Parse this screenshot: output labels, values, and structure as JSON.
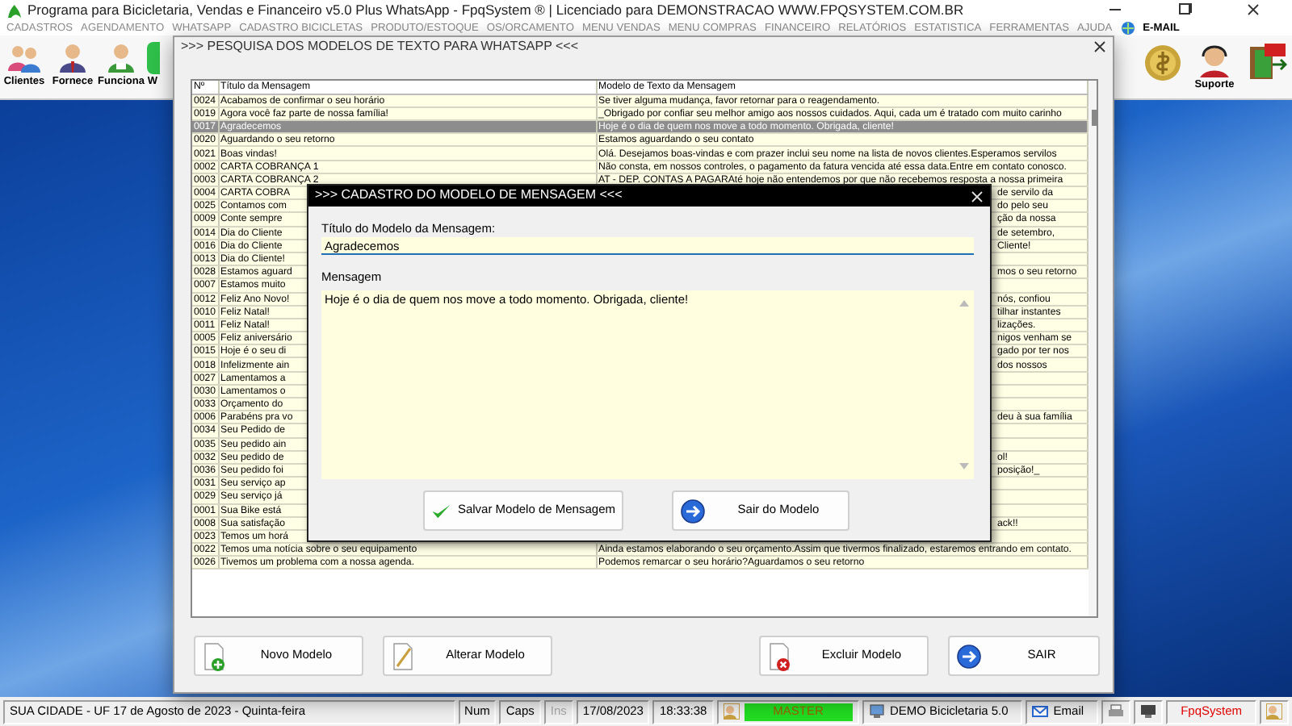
{
  "window": {
    "title": "Programa para Bicicletaria, Vendas e Financeiro v5.0 Plus WhatsApp - FpqSystem ® | Licenciado para  DEMONSTRACAO WWW.FPQSYSTEM.COM.BR"
  },
  "menu": [
    {
      "label": "CADASTROS",
      "disabled": true
    },
    {
      "label": "AGENDAMENTO",
      "disabled": true
    },
    {
      "label": "WHATSAPP",
      "disabled": true
    },
    {
      "label": "CADASTRO BICICLETAS",
      "disabled": true
    },
    {
      "label": "PRODUTO/ESTOQUE",
      "disabled": true
    },
    {
      "label": "OS/ORCAMENTO",
      "disabled": true
    },
    {
      "label": "MENU VENDAS",
      "disabled": true
    },
    {
      "label": "MENU COMPRAS",
      "disabled": true
    },
    {
      "label": "FINANCEIRO",
      "disabled": true
    },
    {
      "label": "RELATÓRIOS",
      "disabled": true
    },
    {
      "label": "ESTATISTICA",
      "disabled": true
    },
    {
      "label": "FERRAMENTAS",
      "disabled": true
    },
    {
      "label": "AJUDA",
      "disabled": true
    },
    {
      "label": "E-MAIL",
      "disabled": false
    }
  ],
  "toolbar_left": [
    {
      "kind": "clients",
      "label": "Clientes"
    },
    {
      "kind": "suppliers",
      "label": "Fornece"
    },
    {
      "kind": "staff",
      "label": "Funciona"
    },
    {
      "kind": "whatsapp",
      "label": "W"
    }
  ],
  "toolbar_right": [
    {
      "kind": "coin"
    },
    {
      "kind": "support",
      "label": "Suporte"
    },
    {
      "kind": "exit"
    }
  ],
  "search_dialog": {
    "title": ">>> PESQUISA DOS MODELOS DE TEXTO PARA WHATSAPP <<<",
    "columns": [
      "Nº",
      "Título da Mensagem",
      "Modelo de Texto da Mensagem"
    ],
    "rows": [
      {
        "number": "0024",
        "title": "Acabamos de confirmar o seu horário",
        "model": "Se tiver alguma mudança, favor retornar para o reagendamento.",
        "selected": false,
        "covered": false
      },
      {
        "number": "0019",
        "title": "Agora você faz parte de nossa família!",
        "model": "_Obrigado por confiar seu melhor amigo aos nossos cuidados. Aqui, cada um é tratado com muito carinho",
        "selected": false,
        "covered": false
      },
      {
        "number": "0017",
        "title": "Agradecemos",
        "model": "Hoje é o dia de quem nos move a todo momento. Obrigada, cliente!",
        "selected": true,
        "covered": false
      },
      {
        "number": "0020",
        "title": "Aguardando o seu retorno",
        "model": "Estamos aguardando o seu contato",
        "selected": false,
        "covered": false
      },
      {
        "number": "0021",
        "title": "Boas vindas!",
        "model": "Olá. Desejamos boas-vindas e com prazer inclui seu nome na lista de novos clientes.Esperamos servilos",
        "selected": false,
        "covered": false
      },
      {
        "number": "0002",
        "title": "CARTA COBRANÇA 1",
        "model": "Não consta, em nossos controles, o pagamento da fatura vencida até essa data.Entre em contato conosco.",
        "selected": false,
        "covered": false
      },
      {
        "number": "0003",
        "title": "CARTA COBRANÇA 2",
        "model": "AT - DEP. CONTAS A PAGARAté hoje não entendemos por que não recebemos resposta a nossa primeira",
        "selected": false,
        "covered": false
      },
      {
        "number": "0004",
        "title": "CARTA COBRA",
        "model": "de servilo da",
        "selected": false,
        "covered": true
      },
      {
        "number": "0025",
        "title": "Contamos com",
        "model": "do pelo seu",
        "selected": false,
        "covered": true
      },
      {
        "number": "0009",
        "title": "Conte sempre",
        "model": "ção da nossa",
        "selected": false,
        "covered": true
      },
      {
        "number": "0014",
        "title": "Dia do Cliente",
        "model": "de setembro,",
        "selected": false,
        "covered": true
      },
      {
        "number": "0016",
        "title": "Dia do Cliente",
        "model": "Cliente!",
        "selected": false,
        "covered": true
      },
      {
        "number": "0013",
        "title": "Dia do Cliente!",
        "selected": false
      },
      {
        "number": "0028",
        "title": "Estamos aguard",
        "model": "mos o seu retorno",
        "selected": false,
        "covered": true
      },
      {
        "number": "0007",
        "title": "Estamos muito",
        "selected": false
      },
      {
        "number": "0012",
        "title": "Feliz Ano Novo!",
        "model": "nós, confiou",
        "selected": false,
        "covered": true
      },
      {
        "number": "0010",
        "title": "Feliz Natal!",
        "model": "tilhar instantes",
        "selected": false,
        "covered": true
      },
      {
        "number": "0011",
        "title": "Feliz Natal!",
        "model": "lizações.",
        "selected": false,
        "covered": true
      },
      {
        "number": "0005",
        "title": "Feliz aniversário",
        "model": "nigos venham se",
        "selected": false,
        "covered": true
      },
      {
        "number": "0015",
        "title": "Hoje é o seu di",
        "model": "gado por ter nos",
        "selected": false,
        "covered": true
      },
      {
        "number": "0018",
        "title": "Infelizmente ain",
        "model": "dos nossos",
        "selected": false,
        "covered": true
      },
      {
        "number": "0027",
        "title": "Lamentamos a",
        "selected": false
      },
      {
        "number": "0030",
        "title": "Lamentamos o",
        "selected": false
      },
      {
        "number": "0033",
        "title": "Orçamento do",
        "selected": false
      },
      {
        "number": "0006",
        "title": "Parabéns pra vo",
        "model": "deu à sua família",
        "selected": false,
        "covered": true
      },
      {
        "number": "0034",
        "title": "Seu Pedido de",
        "selected": false
      },
      {
        "number": "0035",
        "title": "Seu pedido ain",
        "selected": false
      },
      {
        "number": "0032",
        "title": "Seu pedido de",
        "model": "ol!",
        "selected": false,
        "covered": true
      },
      {
        "number": "0036",
        "title": "Seu pedido foi",
        "model": "posição!_",
        "selected": false,
        "covered": true
      },
      {
        "number": "0031",
        "title": "Seu serviço ap",
        "selected": false
      },
      {
        "number": "0029",
        "title": "Seu serviço já",
        "selected": false
      },
      {
        "number": "0001",
        "title": "Sua Bike está",
        "selected": false
      },
      {
        "number": "0008",
        "title": "Sua satisfação",
        "model": "ack!!",
        "selected": false,
        "covered": true
      },
      {
        "number": "0023",
        "title": "Temos um horá",
        "selected": false
      },
      {
        "number": "0022",
        "title": "Temos uma notícia sobre o seu equipamento",
        "model": "Ainda estamos elaborando o seu orçamento.Assim que tivermos finalizado, estaremos entrando em contato.",
        "selected": false,
        "covered": false
      },
      {
        "number": "0026",
        "title": "Tivemos um problema com a nossa agenda.",
        "model": "Podemos remarcar o seu horário?Aguardamos o seu retorno",
        "selected": false,
        "covered": false
      }
    ],
    "buttons": [
      {
        "kind": "new",
        "label": "Novo Modelo"
      },
      {
        "kind": "edit",
        "label": "Alterar Modelo"
      },
      {
        "kind": "delete",
        "label": "Excluir Modelo"
      },
      {
        "kind": "exit",
        "label": "SAIR"
      }
    ]
  },
  "edit_dialog": {
    "title": ">>> CADASTRO DO MODELO DE MENSAGEM <<<",
    "title_label": "Título do Modelo da Mensagem:",
    "title_value": "Agradecemos",
    "message_label": "Mensagem",
    "message_value": "Hoje é o dia de quem nos move a todo momento. Obrigada, cliente!",
    "buttons": [
      {
        "kind": "save",
        "label": "Salvar Modelo de Mensagem"
      },
      {
        "kind": "exit",
        "label": "Sair do Modelo"
      }
    ]
  },
  "status_bar": [
    {
      "kind": "text",
      "text": "SUA CIDADE - UF 17 de Agosto de 2023 - Quinta-feira"
    },
    {
      "kind": "key",
      "text": "Num",
      "disabled": false
    },
    {
      "kind": "key",
      "text": "Caps",
      "disabled": false
    },
    {
      "kind": "key",
      "text": "Ins",
      "disabled": true
    },
    {
      "kind": "text",
      "text": "17/08/2023"
    },
    {
      "kind": "text",
      "text": "18:33:38"
    },
    {
      "kind": "user",
      "text": "MASTER"
    },
    {
      "kind": "company",
      "text": "DEMO Bicicletaria 5.0"
    },
    {
      "kind": "email",
      "text": "Email"
    },
    {
      "kind": "printer"
    },
    {
      "kind": "monitor"
    },
    {
      "kind": "brand",
      "text": "FpqSystem"
    },
    {
      "kind": "users"
    }
  ]
}
